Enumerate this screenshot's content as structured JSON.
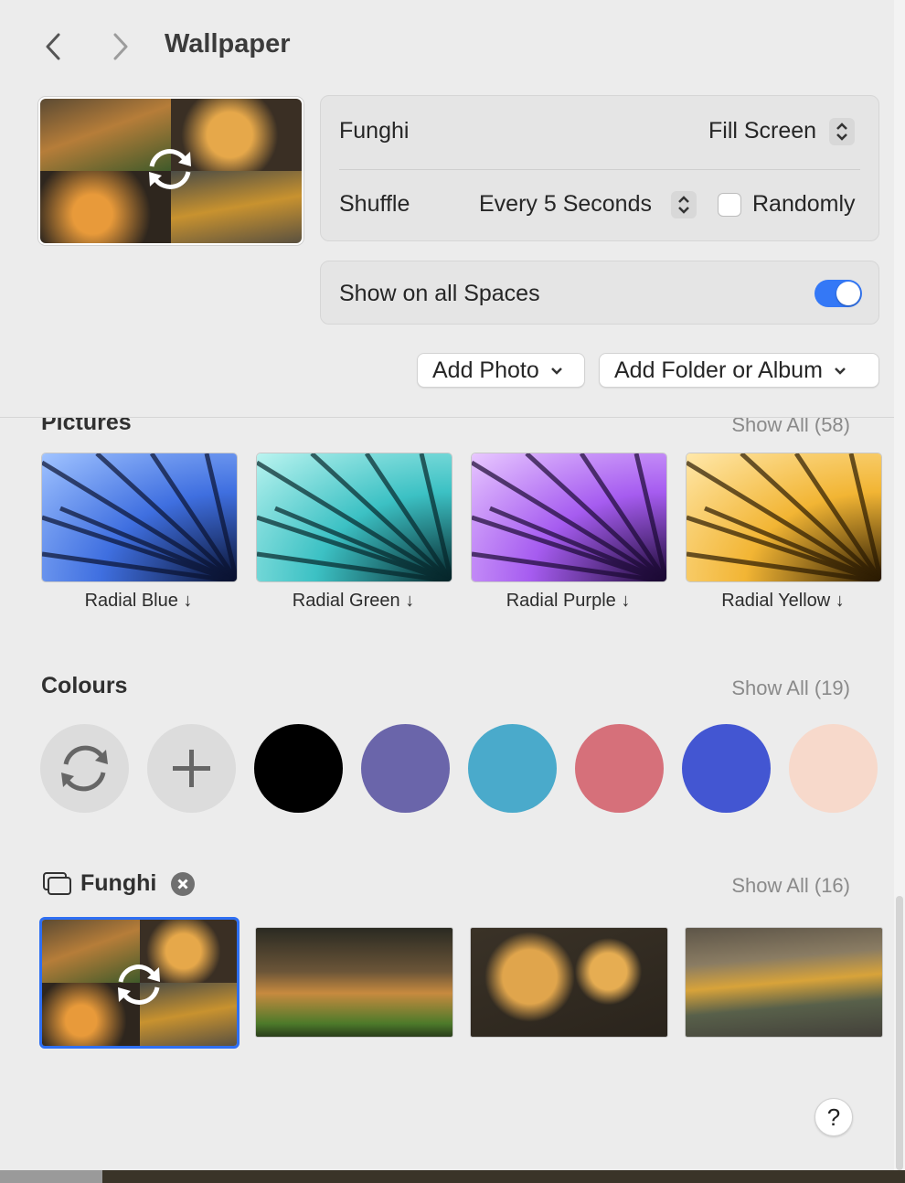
{
  "header": {
    "title": "Wallpaper"
  },
  "settings": {
    "wallpaper_name": "Funghi",
    "fit_value": "Fill Screen",
    "shuffle_label": "Shuffle",
    "shuffle_value": "Every 5 Seconds",
    "randomly_label": "Randomly",
    "randomly_checked": false
  },
  "spaces": {
    "label": "Show on all Spaces",
    "enabled": true
  },
  "buttons": {
    "add_photo": "Add Photo",
    "add_folder": "Add Folder or Album"
  },
  "pictures": {
    "title": "Pictures",
    "show_all": "Show All (58)",
    "items": [
      {
        "label": "Radial Blue ↓",
        "color": "#3f6fe0"
      },
      {
        "label": "Radial Green ↓",
        "color": "#3cc1c4"
      },
      {
        "label": "Radial Purple ↓",
        "color": "#a65cf0"
      },
      {
        "label": "Radial Yellow ↓",
        "color": "#f2b534"
      }
    ]
  },
  "colours": {
    "title": "Colours",
    "show_all": "Show All (19)",
    "swatches": [
      "#000000",
      "#6a65aa",
      "#4aaacb",
      "#d6707a",
      "#4356d2",
      "#f7d9cb"
    ]
  },
  "funghi": {
    "title": "Funghi",
    "show_all": "Show All (16)"
  },
  "help": "?"
}
